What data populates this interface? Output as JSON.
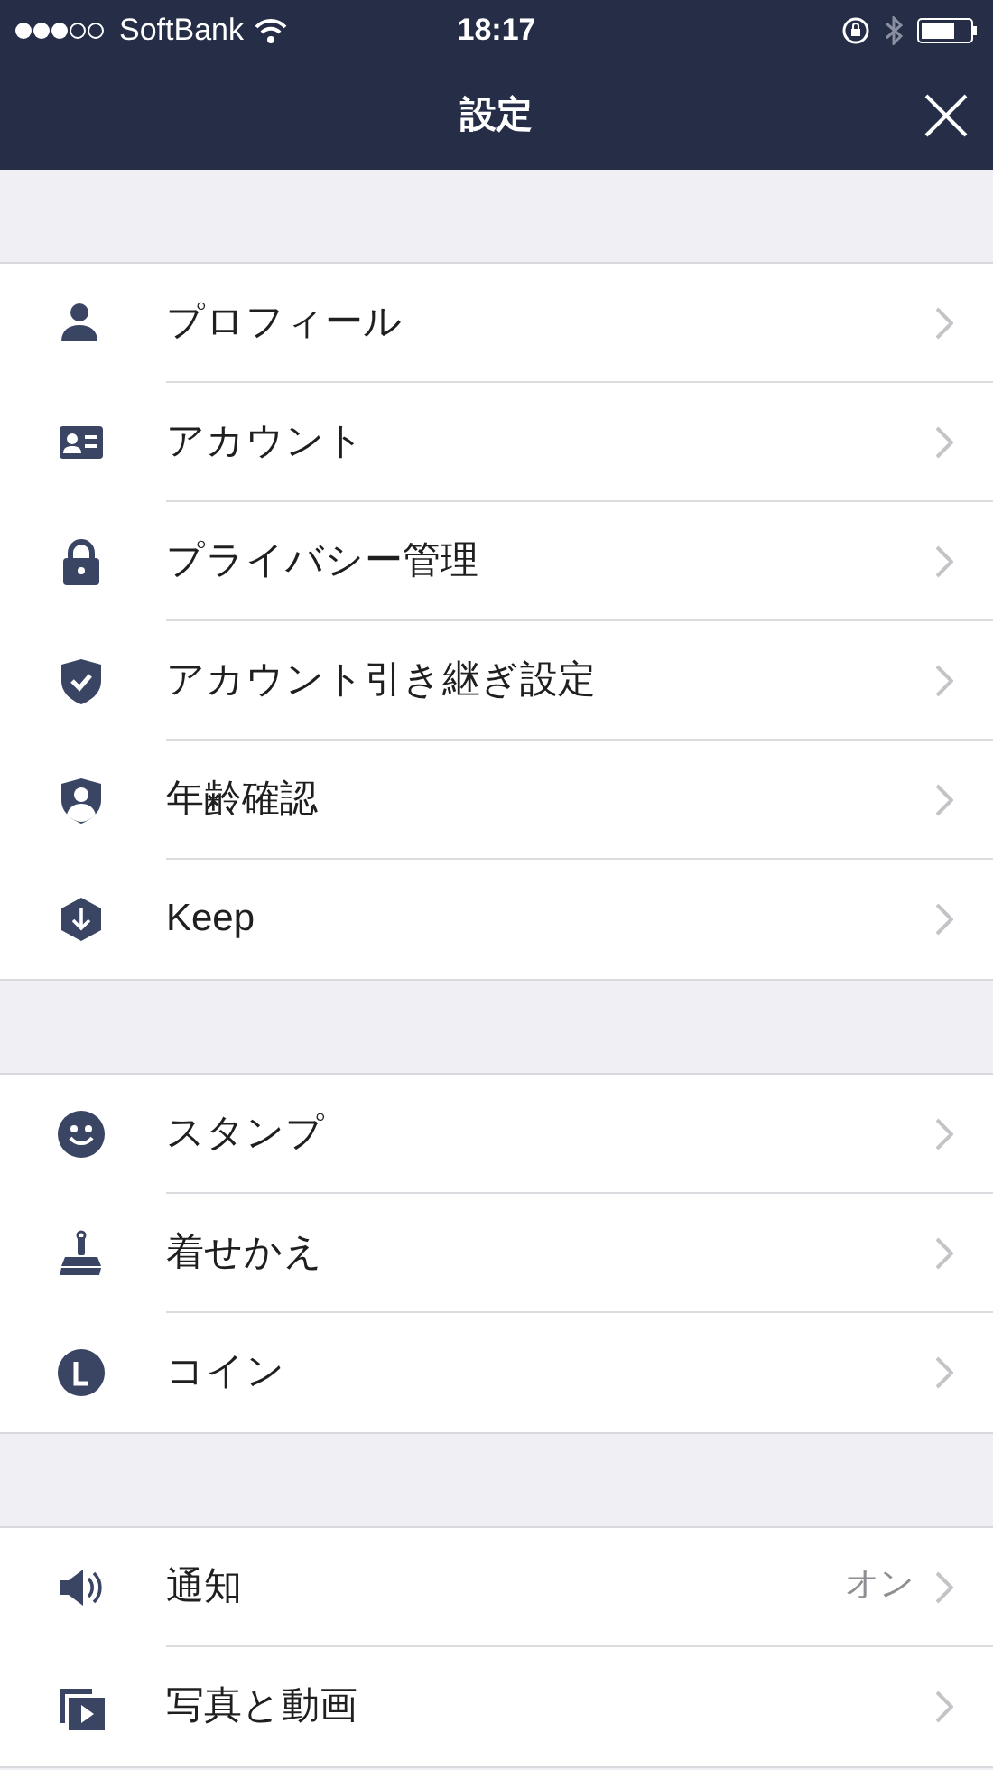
{
  "status_bar": {
    "carrier": "SoftBank",
    "time": "18:17"
  },
  "nav": {
    "title": "設定"
  },
  "sections": [
    {
      "items": [
        {
          "kind": "person",
          "label": "プロフィール"
        },
        {
          "kind": "idcard",
          "label": "アカウント"
        },
        {
          "kind": "lock",
          "label": "プライバシー管理"
        },
        {
          "kind": "shieldcheck",
          "label": "アカウント引き継ぎ設定"
        },
        {
          "kind": "shieldperson",
          "label": "年齢確認"
        },
        {
          "kind": "keep",
          "label": "Keep"
        }
      ]
    },
    {
      "items": [
        {
          "kind": "smile",
          "label": "スタンプ"
        },
        {
          "kind": "brush",
          "label": "着せかえ"
        },
        {
          "kind": "coin",
          "label": "コイン"
        }
      ]
    },
    {
      "items": [
        {
          "kind": "speaker",
          "label": "通知",
          "value": "オン"
        },
        {
          "kind": "media",
          "label": "写真と動画"
        }
      ]
    }
  ]
}
